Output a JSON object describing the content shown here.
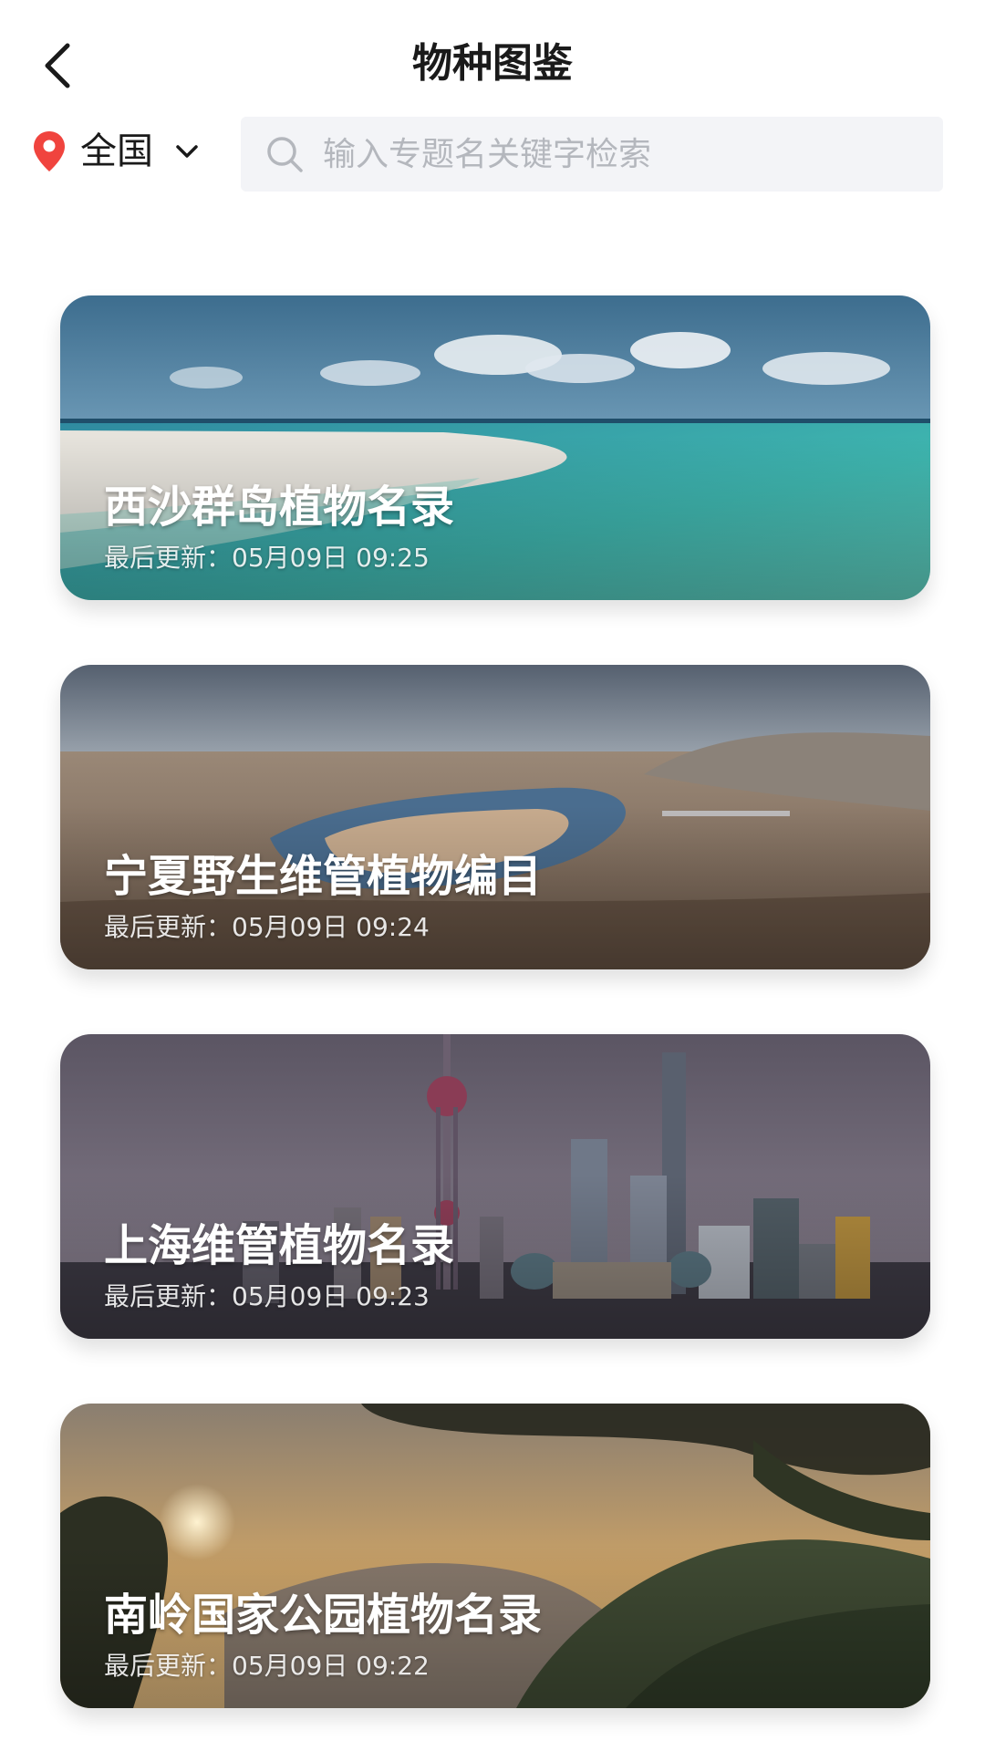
{
  "header": {
    "back_icon": "chevron-left-icon",
    "title": "物种图鉴"
  },
  "filter": {
    "region": "全国",
    "region_icon": "location-pin-icon",
    "dropdown_icon": "chevron-down-icon"
  },
  "search": {
    "icon": "search-icon",
    "placeholder": "输入专题名关键字检索",
    "value": ""
  },
  "cards": [
    {
      "title": "西沙群岛植物名录",
      "updated": "最后更新：05月09日 09:25",
      "image": "tropical-beach-photo"
    },
    {
      "title": "宁夏野生维管植物编目",
      "updated": "最后更新：05月09日 09:24",
      "image": "river-canyon-photo"
    },
    {
      "title": "上海维管植物名录",
      "updated": "最后更新：05月09日 09:23",
      "image": "city-skyline-photo"
    },
    {
      "title": "南岭国家公园植物名录",
      "updated": "最后更新：05月09日 09:22",
      "image": "mountain-sunset-photo"
    }
  ],
  "colors": {
    "pin": "#f0443e",
    "search_bg": "#f3f4f7",
    "placeholder": "#b4b7bd"
  }
}
